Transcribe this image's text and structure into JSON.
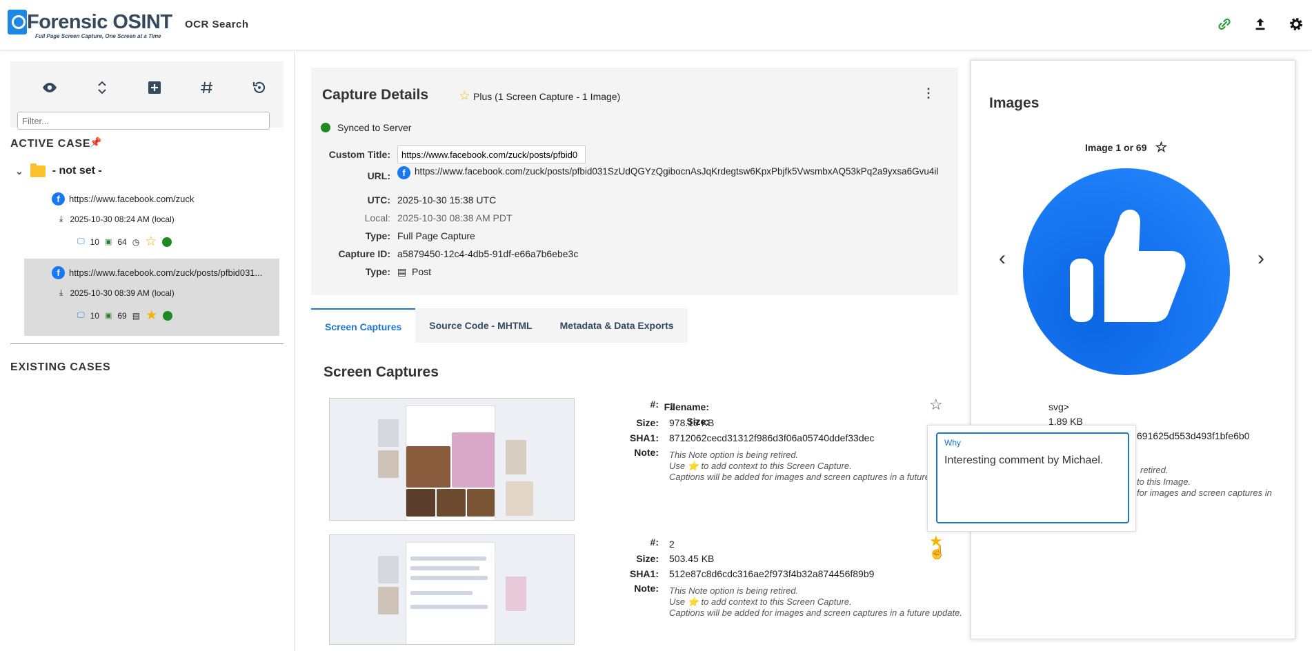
{
  "header": {
    "brand": "Forensic OSINT",
    "tagline": "Full Page Screen Capture, One Screen at a Time",
    "nav_ocr": "OCR Search"
  },
  "sidebar": {
    "filter_placeholder": "Filter...",
    "active_case_title": "ACTIVE CASE",
    "case_name": "- not set -",
    "items": [
      {
        "url": "https://www.facebook.com/zuck",
        "date": "2025-10-30 08:24 AM (local)",
        "screens": "10",
        "images": "64"
      },
      {
        "url": "https://www.facebook.com/zuck/posts/pfbid031...",
        "date": "2025-10-30 08:39 AM (local)",
        "screens": "10",
        "images": "69"
      }
    ],
    "existing_cases_title": "EXISTING CASES"
  },
  "details": {
    "title": "Capture Details",
    "plan": "Plus (1 Screen Capture - 1 Image)",
    "synced": "Synced to Server",
    "custom_title_label": "Custom Title:",
    "custom_title_value": "https://www.facebook.com/zuck/posts/pfbid0",
    "url_label": "URL:",
    "url_value": "https://www.facebook.com/zuck/posts/pfbid031SzUdQGYzQgibocnAsJqKrdegtsw6KpxPbjfk5VwsmbxAQ53kPq2a9yxsa6Gvu4il",
    "utc_label": "UTC:",
    "utc_value": "2025-10-30 15:38 UTC",
    "local_label": "Local:",
    "local_value": "2025-10-30 08:38 AM PDT",
    "type_label": "Type:",
    "type_value": "Full Page Capture",
    "capture_id_label": "Capture ID:",
    "capture_id_value": "a5879450-12c4-4db5-91df-e66a7b6ebe3c",
    "type2_label": "Type:",
    "type2_value": "Post"
  },
  "tabs": [
    {
      "label": "Screen Captures"
    },
    {
      "label": "Source Code - MHTML"
    },
    {
      "label": "Metadata & Data Exports"
    }
  ],
  "screen_captures": {
    "title": "Screen Captures",
    "labels": {
      "num": "#:",
      "size": "Size:",
      "sha1": "SHA1:",
      "note": "Note:"
    },
    "note_lines": [
      "This Note option is being retired.",
      "Use ⭐ to add context to this Screen Capture.",
      "Captions will be added for images and screen captures in a future update."
    ],
    "items": [
      {
        "num": "1",
        "size": "978.18 KB",
        "sha1": "8712062cecd31312f986d3f06a05740ddef33dec"
      },
      {
        "num": "2",
        "size": "503.45 KB",
        "sha1": "512e87c8d6cdc316ae2f973f4b32a874456f89b9"
      }
    ]
  },
  "images": {
    "title": "Images",
    "counter": "Image 1 or 69",
    "filename_label": "Filename:",
    "filename_value": "svg>",
    "size_label": "Size:",
    "size_value": "1.89 KB",
    "sha1_partial": "691625d553d493f1bfe6b0",
    "note_partial_1": "retired.",
    "note_partial_2": "to this Image.",
    "note_partial_3": "for images and screen captures in"
  },
  "popover": {
    "label": "Why",
    "value": "Interesting comment by Michael."
  }
}
